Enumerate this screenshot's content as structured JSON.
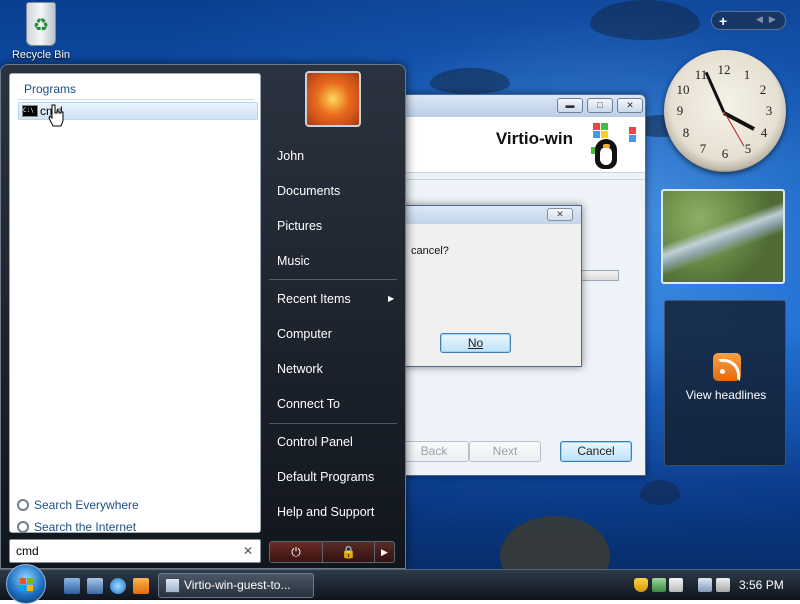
{
  "desktop": {
    "recycle_bin_label": "Recycle Bin"
  },
  "installer": {
    "brand": "Virtio-win",
    "buttons": {
      "back": "Back",
      "next": "Next",
      "cancel": "Cancel"
    },
    "titlebar_icons": {
      "minimize": "minimize-icon",
      "maximize": "maximize-icon",
      "close": "close-icon"
    }
  },
  "dialog": {
    "message_visible": "cancel?",
    "no_button": "No"
  },
  "start_menu": {
    "programs_header": "Programs",
    "program_result": "cmd",
    "search_links": [
      "Search Everywhere",
      "Search the Internet"
    ],
    "search_query": "cmd",
    "user_name": "John",
    "right_items": [
      "Documents",
      "Pictures",
      "Music",
      "Recent Items",
      "Computer",
      "Network",
      "Connect To",
      "Control Panel",
      "Default Programs",
      "Help and Support"
    ],
    "power_icons": [
      "power-icon",
      "lock-icon",
      "arrow-right-icon"
    ]
  },
  "sidebar": {
    "feeds_label": "View headlines"
  },
  "taskbar": {
    "task_button": "Virtio-win-guest-to...",
    "time": "3:56 PM"
  },
  "colors": {
    "accent_blue": "#1b4f8a",
    "taskbar": "#1b2430",
    "rss_orange": "#f08a2a"
  }
}
